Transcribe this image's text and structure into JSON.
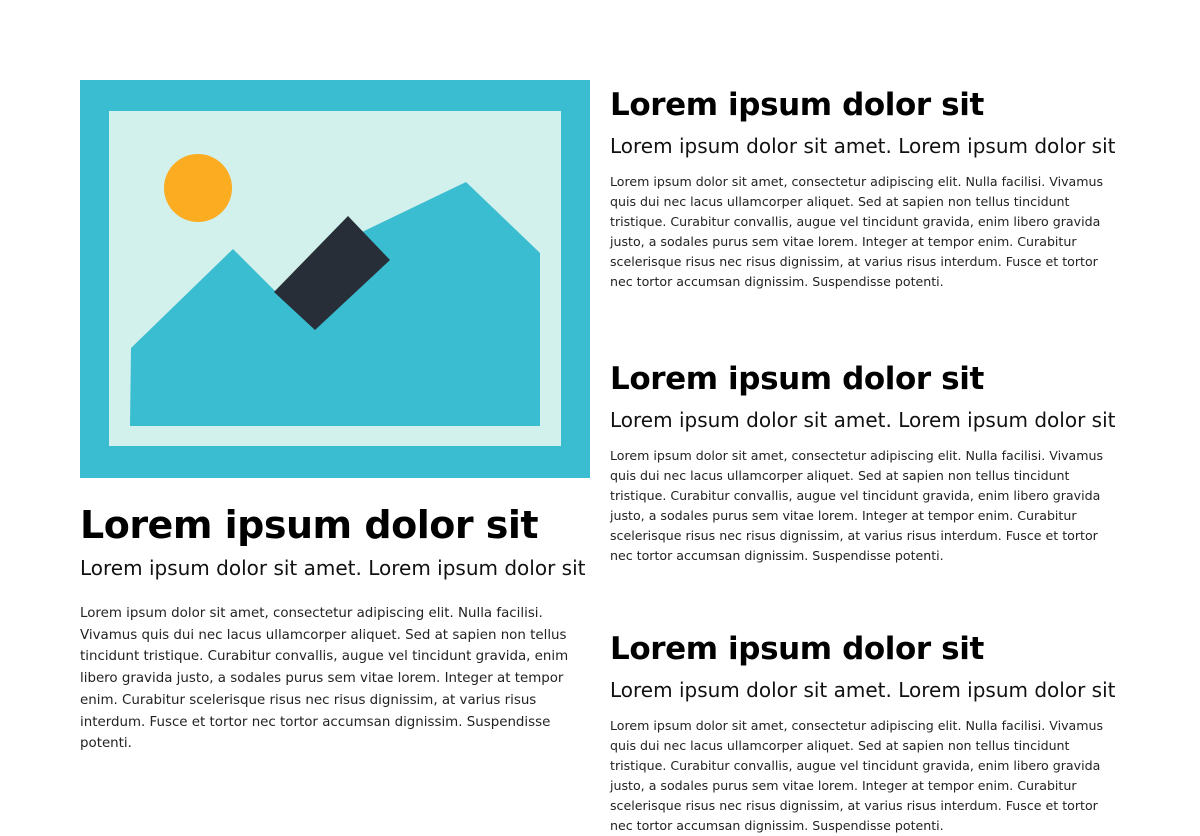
{
  "colors": {
    "image_frame": "#3ABDD0",
    "image_sky": "#D2F0EC",
    "image_sun": "#FBAC20",
    "image_mountain": "#3ABDD0",
    "image_dark_block": "#272E38"
  },
  "feature": {
    "image_icon": "image-placeholder-icon",
    "title": "Lorem ipsum dolor sit",
    "subtitle": "Lorem ipsum dolor sit amet. Lorem ipsum dolor sit",
    "body": "Lorem ipsum dolor sit amet, consectetur adipiscing elit. Nulla facilisi. Vivamus quis dui nec lacus ullamcorper aliquet. Sed at sapien non tellus tincidunt tristique. Curabitur convallis, augue vel tincidunt gravida, enim libero gravida justo, a sodales purus sem vitae lorem. Integer at tempor enim. Curabitur scelerisque risus nec risus dignissim, at varius risus interdum. Fusce et tortor nec tortor accumsan dignissim. Suspendisse potenti."
  },
  "articles": [
    {
      "title": "Lorem ipsum dolor sit",
      "subtitle": "Lorem ipsum dolor sit amet. Lorem ipsum dolor sit",
      "body": "Lorem ipsum dolor sit amet, consectetur adipiscing elit. Nulla facilisi. Vivamus quis dui nec lacus ullamcorper aliquet. Sed at sapien non tellus tincidunt tristique. Curabitur convallis, augue vel tincidunt gravida, enim libero gravida justo, a sodales purus sem vitae lorem. Integer at tempor enim. Curabitur scelerisque risus nec risus dignissim, at varius risus interdum. Fusce et tortor nec tortor accumsan dignissim. Suspendisse potenti."
    },
    {
      "title": "Lorem ipsum dolor sit",
      "subtitle": "Lorem ipsum dolor sit amet. Lorem ipsum dolor sit",
      "body": "Lorem ipsum dolor sit amet, consectetur adipiscing elit. Nulla facilisi. Vivamus quis dui nec lacus ullamcorper aliquet. Sed at sapien non tellus tincidunt tristique. Curabitur convallis, augue vel tincidunt gravida, enim libero gravida justo, a sodales purus sem vitae lorem. Integer at tempor enim. Curabitur scelerisque risus nec risus dignissim, at varius risus interdum. Fusce et tortor nec tortor accumsan dignissim. Suspendisse potenti."
    },
    {
      "title": "Lorem ipsum dolor sit",
      "subtitle": "Lorem ipsum dolor sit amet. Lorem ipsum dolor sit",
      "body": "Lorem ipsum dolor sit amet, consectetur adipiscing elit. Nulla facilisi. Vivamus quis dui nec lacus ullamcorper aliquet. Sed at sapien non tellus tincidunt tristique. Curabitur convallis, augue vel tincidunt gravida, enim libero gravida justo, a sodales purus sem vitae lorem. Integer at tempor enim. Curabitur scelerisque risus nec risus dignissim, at varius risus interdum. Fusce et tortor nec tortor accumsan dignissim. Suspendisse potenti."
    }
  ]
}
